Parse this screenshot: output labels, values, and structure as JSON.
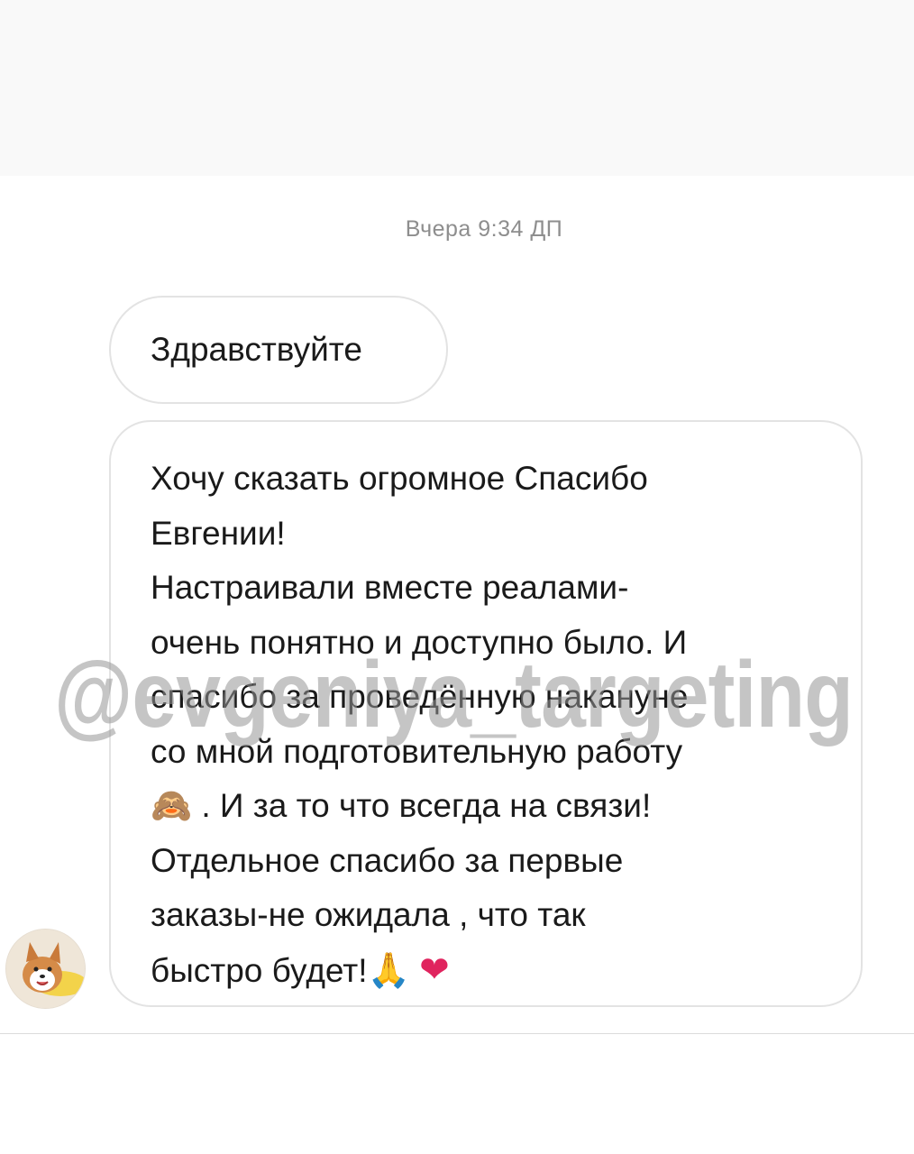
{
  "thread": {
    "timestamp": "Вчера 9:34 ДП"
  },
  "messages": [
    {
      "text": "Здравствуйте"
    },
    {
      "lines": [
        "Хочу сказать огромное Спасибо",
        "Евгении!",
        "Настраивали вместе реалами-",
        "очень понятно и доступно было. И",
        "спасибо за проведённую накануне",
        "со мной подготовительную работу",
        ". И за то что всегда на связи!",
        "Отдельное спасибо за первые",
        "заказы-не ожидала , что так",
        "быстро будет!"
      ],
      "emojis": {
        "see_no_evil": "🙈",
        "pray": "🙏",
        "heart": "❤"
      }
    }
  ],
  "watermark": "@evgeniya_targeting",
  "avatar_icon": "corgi-avatar-icon"
}
